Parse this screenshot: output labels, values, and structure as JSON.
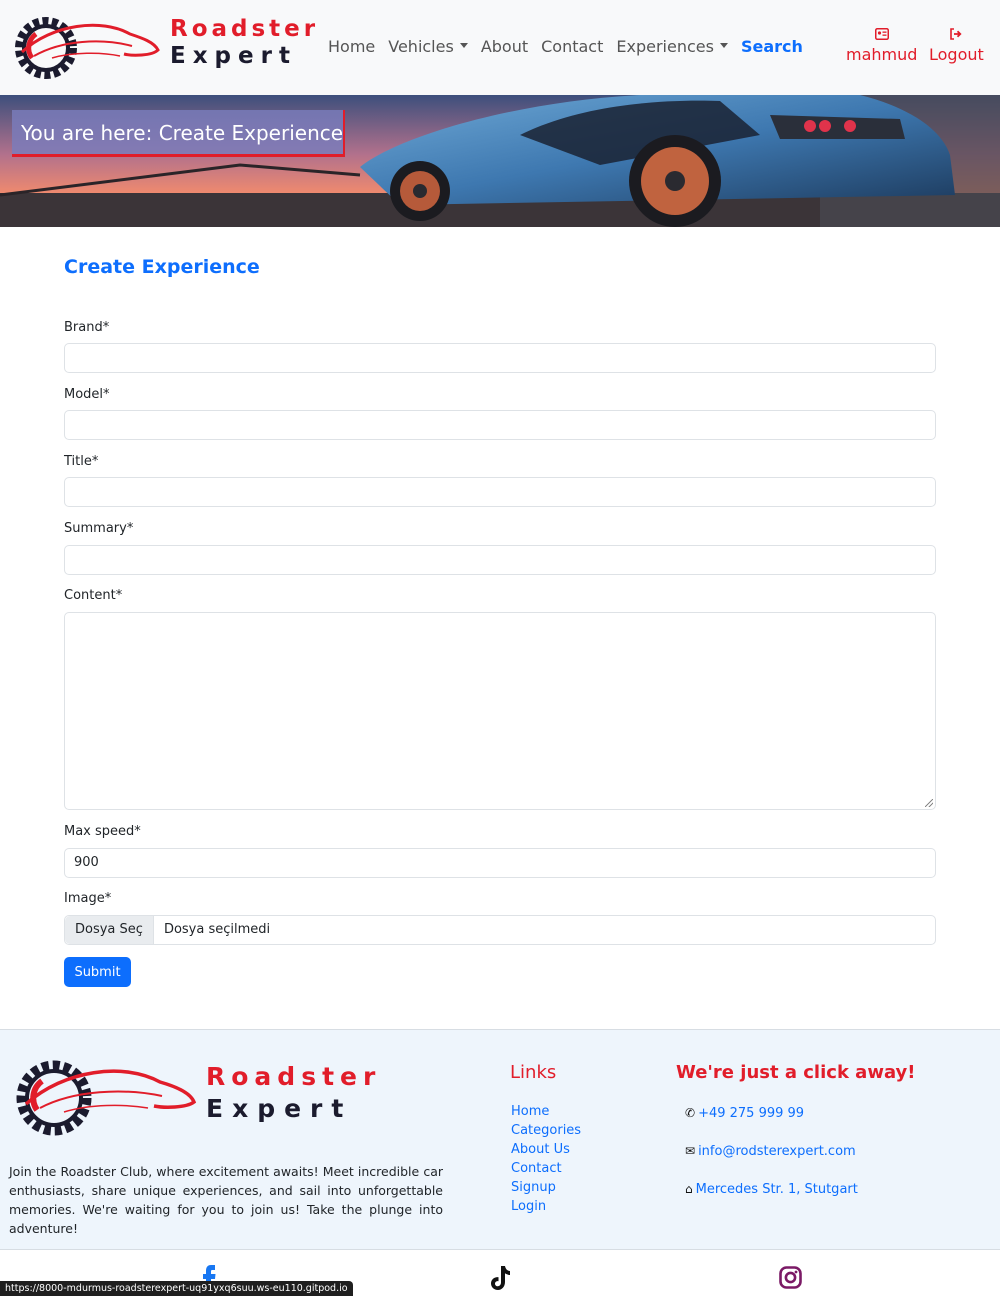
{
  "brand": {
    "line1": "Roadster",
    "line2": "Expert"
  },
  "nav": {
    "home": "Home",
    "vehicles": "Vehicles",
    "about": "About",
    "contact": "Contact",
    "experiences": "Experiences",
    "search": "Search",
    "username": "mahmud",
    "logout": "Logout"
  },
  "hero": {
    "breadcrumb": "You are here: Create Experience"
  },
  "form": {
    "title": "Create Experience",
    "brand_label": "Brand*",
    "brand_value": "",
    "model_label": "Model*",
    "model_value": "",
    "title_label": "Title*",
    "title_value": "",
    "summary_label": "Summary*",
    "summary_value": "",
    "content_label": "Content*",
    "content_value": "",
    "max_speed_label": "Max speed*",
    "max_speed_value": "900",
    "image_label": "Image*",
    "file_button": "Dosya Seç",
    "file_status": "Dosya seçilmedi",
    "submit": "Submit"
  },
  "footer": {
    "description": "Join the Roadster Club, where excitement awaits! Meet incredible car enthusiasts, share unique experiences, and sail into unforgettable memories. We're waiting for you to join us! Take the plunge into adventure!",
    "links_title": "Links",
    "links": [
      "Home",
      "Categories",
      "About Us",
      "Contact",
      "Signup",
      "Login"
    ],
    "contact_title": "We're just a click away!",
    "phone": "+49 275 999 99",
    "email": "info@rodsterexpert.com",
    "address": "Mercedes Str. 1, Stutgart"
  },
  "status_bar": "https://8000-mdurmus-roadsterexpert-uq91yxq6suu.ws-eu110.gitpod.io",
  "colors": {
    "accent": "#0d6efd",
    "brand_red": "#e11d2a",
    "navy": "#1b1b2e"
  }
}
